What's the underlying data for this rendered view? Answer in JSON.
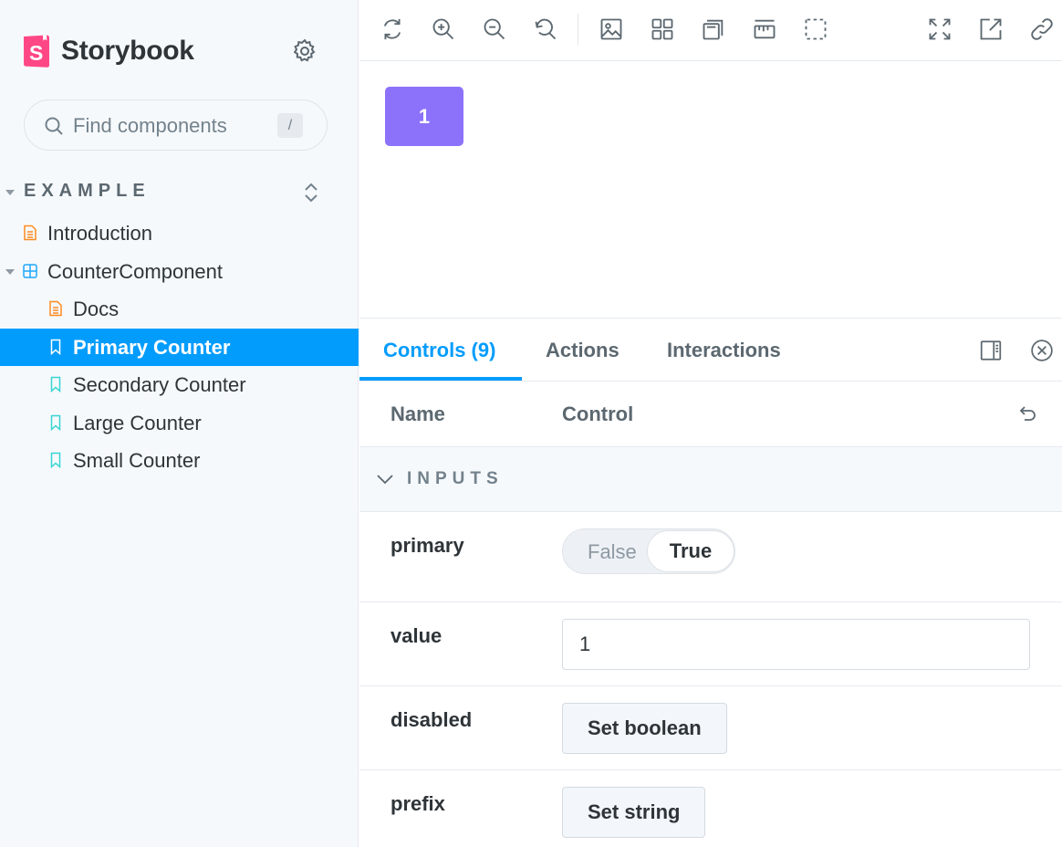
{
  "sidebar": {
    "brand": "Storybook",
    "search": {
      "placeholder": "Find components",
      "shortcut": "/"
    },
    "group_title": "EXAMPLE",
    "items": [
      {
        "label": "Introduction",
        "icon": "document-icon"
      },
      {
        "label": "CounterComponent",
        "icon": "component-icon"
      },
      {
        "label": "Docs",
        "icon": "document-icon"
      },
      {
        "label": "Primary Counter",
        "icon": "bookmark-icon",
        "selected": true
      },
      {
        "label": "Secondary Counter",
        "icon": "bookmark-icon"
      },
      {
        "label": "Large Counter",
        "icon": "bookmark-icon"
      },
      {
        "label": "Small Counter",
        "icon": "bookmark-icon"
      }
    ]
  },
  "toolbar": {
    "left_icons": [
      "refresh-icon",
      "zoom-in-icon",
      "zoom-out-icon",
      "zoom-reset-icon",
      "background-icon",
      "grid-icon",
      "viewport-icon",
      "measure-icon",
      "outline-icon"
    ],
    "right_icons": [
      "fullscreen-icon",
      "open-new-tab-icon",
      "copy-link-icon"
    ]
  },
  "preview": {
    "counter_value": "1"
  },
  "panel": {
    "tabs": [
      {
        "label": "Controls (9)",
        "active": true
      },
      {
        "label": "Actions"
      },
      {
        "label": "Interactions"
      }
    ],
    "columns": {
      "name": "Name",
      "control": "Control"
    },
    "section": "INPUTS",
    "rows": {
      "primary": {
        "name": "primary",
        "false_label": "False",
        "true_label": "True",
        "value": true
      },
      "value": {
        "name": "value",
        "value": "1"
      },
      "disabled": {
        "name": "disabled",
        "button": "Set boolean"
      },
      "prefix": {
        "name": "prefix",
        "button": "Set string"
      }
    }
  },
  "colors": {
    "accent": "#029cfd",
    "counter_bg": "#8c72fa",
    "brand": "#ff4785",
    "doc_icon": "#ff8b1f",
    "story_icon": "#37d5d3",
    "component_icon": "#1ea7fd"
  }
}
